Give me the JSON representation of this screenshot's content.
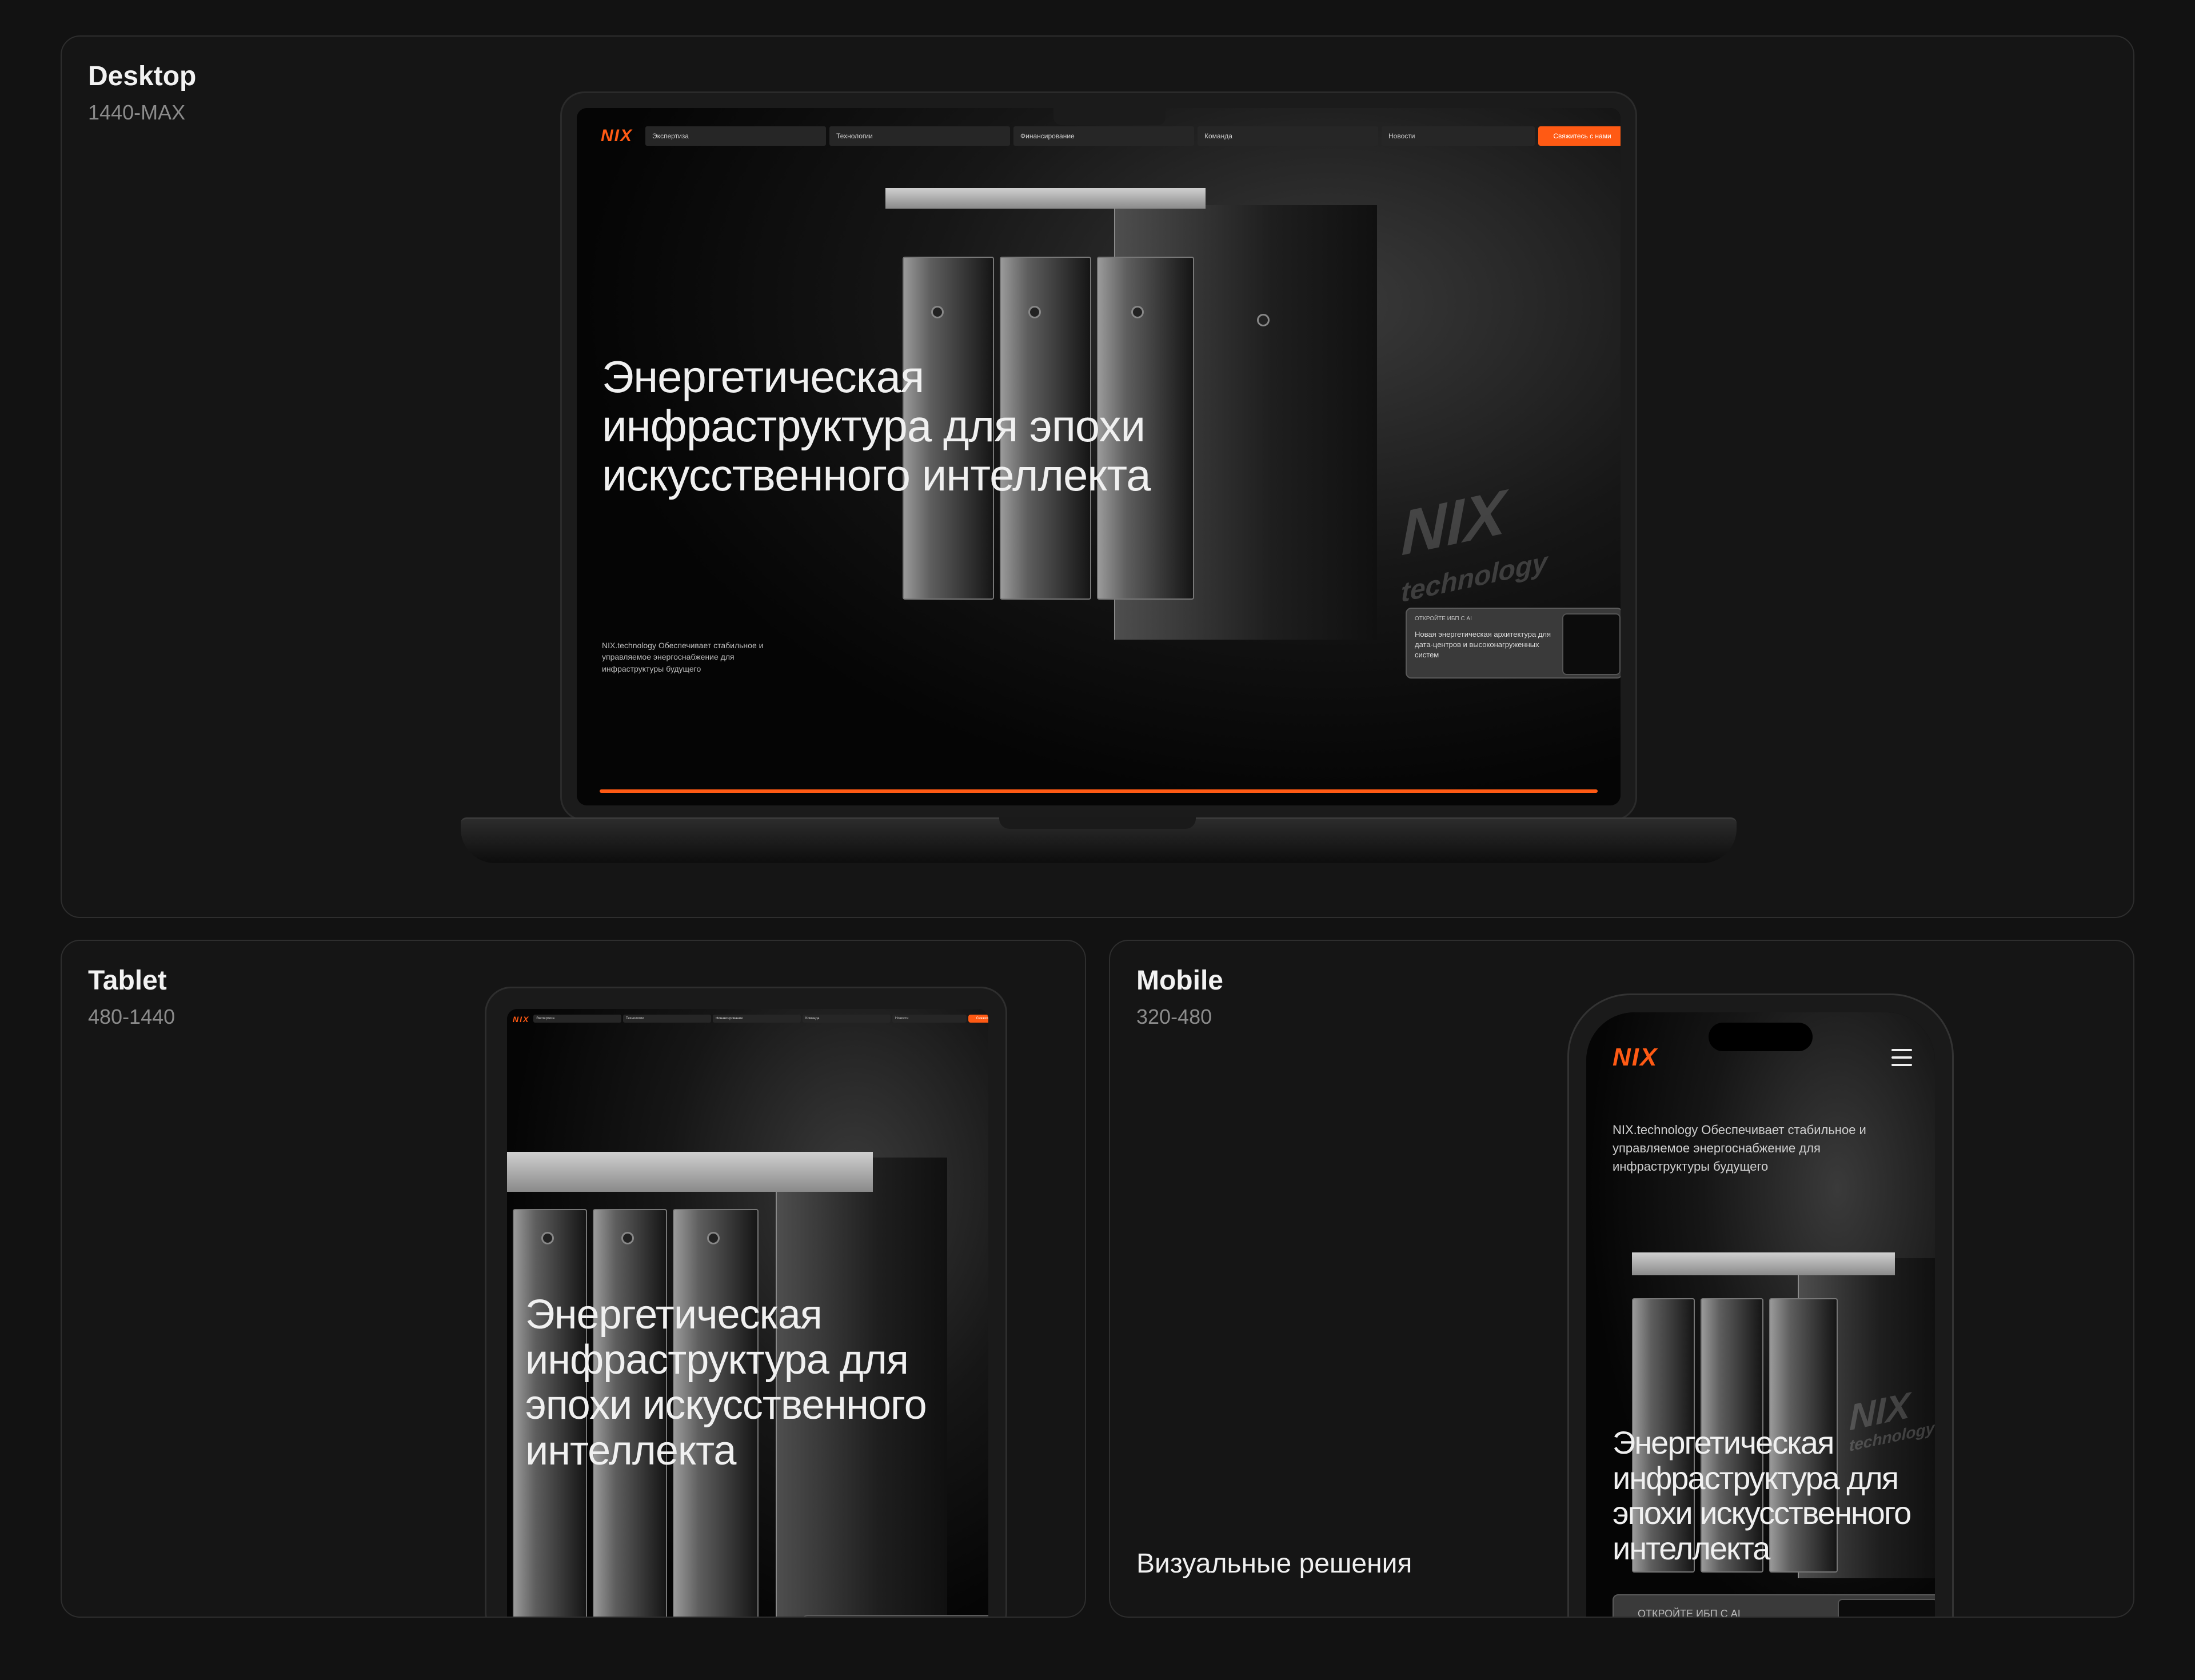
{
  "desktop": {
    "title": "Desktop",
    "range": "1440-MAX"
  },
  "tablet": {
    "title": "Tablet",
    "range": "480-1440"
  },
  "mobile": {
    "title": "Mobile",
    "range": "320-480",
    "section_label": "Визуальные решения"
  },
  "site": {
    "logo": "NIX",
    "nav": [
      "Экспертиза",
      "Технологии",
      "Финансирование",
      "Команда",
      "Новости"
    ],
    "cta": "Свяжитесь с нами",
    "hero_title": "Энергетическая инфраструктура для эпохи искусственного интеллекта",
    "hero_lines_desktop": [
      "Энергетическая",
      "инфраструктура для эпохи",
      "искусственного интеллекта"
    ],
    "hero_lines_tablet": [
      "Энергетическая",
      "инфраструктура для",
      "эпохи искусственного",
      "интеллекта"
    ],
    "description": "NIX.technology Обеспечивает стабильное и управляемое энергоснабжение для инфраструктуры будущего",
    "card_tag": "ОТКРОЙТЕ ИБП С AI",
    "card_text": "Новая энергетическая архитектура для дата-центров и высоконагруженных систем",
    "watermark_top": "NIX",
    "watermark_bottom": "technology",
    "accent_color": "#ff5a14",
    "progress": 1.0
  }
}
